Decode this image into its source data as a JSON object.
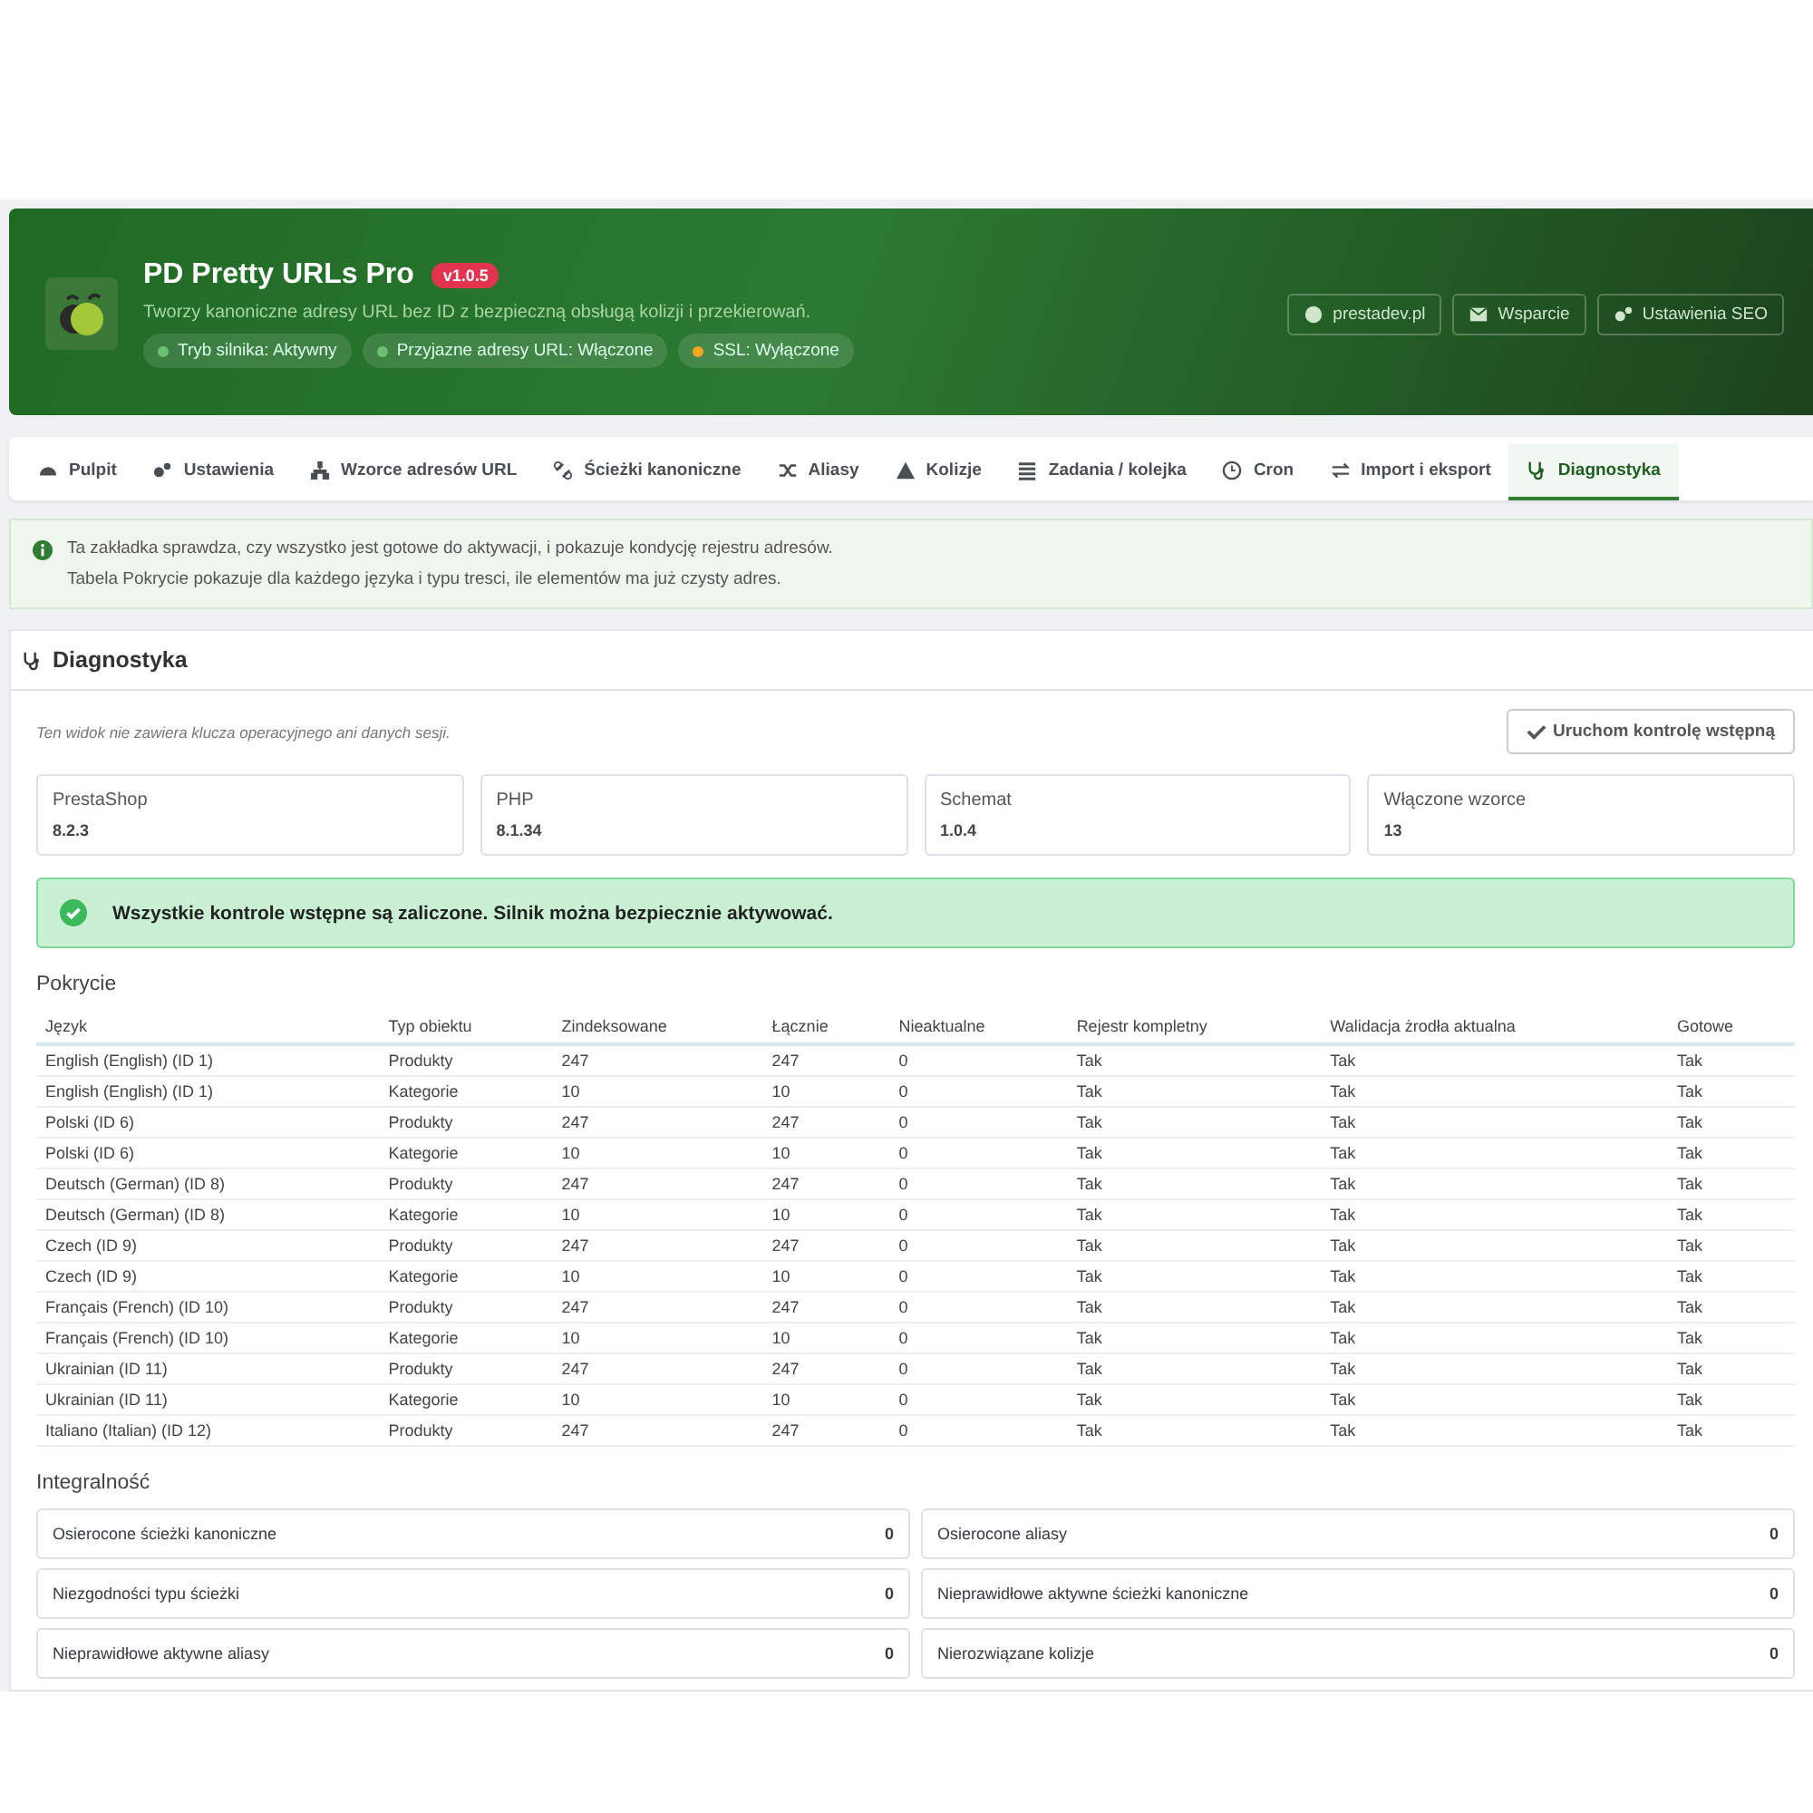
{
  "header": {
    "title": "PD Pretty URLs Pro",
    "version": "v1.0.5",
    "subtitle": "Tworzy kanoniczne adresy URL bez ID z bezpieczną obsługą kolizji i przekierowań.",
    "statuses": [
      {
        "label": "Tryb silnika: Aktywny",
        "color": "#6cc070"
      },
      {
        "label": "Przyjazne adresy URL: Włączone",
        "color": "#6cc070"
      },
      {
        "label": "SSL: Wyłączone",
        "color": "#f5a623"
      }
    ],
    "buttons": [
      "prestadev.pl",
      "Wsparcie",
      "Ustawienia SEO"
    ]
  },
  "tabs": [
    {
      "label": "Pulpit",
      "selected": false
    },
    {
      "label": "Ustawienia",
      "selected": false
    },
    {
      "label": "Wzorce adresów URL",
      "selected": false
    },
    {
      "label": "Ścieżki kanoniczne",
      "selected": false
    },
    {
      "label": "Aliasy",
      "selected": false
    },
    {
      "label": "Kolizje",
      "selected": false
    },
    {
      "label": "Zadania / kolejka",
      "selected": false
    },
    {
      "label": "Cron",
      "selected": false
    },
    {
      "label": "Import i eksport",
      "selected": false
    },
    {
      "label": "Diagnostyka",
      "selected": true
    }
  ],
  "info": [
    "Ta zakładka sprawdza, czy wszystko jest gotowe do aktywacji, i pokazuje kondycję rejestru adresów.",
    "Tabela Pokrycie pokazuje dla każdego języka i typu tresci, ile elementów ma już czysty adres."
  ],
  "panel": {
    "title": "Diagnostyka",
    "note": "Ten widok nie zawiera klucza operacyjnego ani danych sesji.",
    "run_button": "Uruchom kontrolę wstępną",
    "stats": [
      {
        "label": "PrestaShop",
        "value": "8.2.3"
      },
      {
        "label": "PHP",
        "value": "8.1.34"
      },
      {
        "label": "Schemat",
        "value": "1.0.4"
      },
      {
        "label": "Włączone wzorce",
        "value": "13"
      }
    ],
    "success": "Wszystkie kontrole wstępne są zaliczone. Silnik można bezpiecznie aktywować.",
    "coverage": {
      "title": "Pokrycie",
      "columns": [
        "Język",
        "Typ obiektu",
        "Zindeksowane",
        "Łącznie",
        "Nieaktualne",
        "Rejestr kompletny",
        "Walidacja żrodła aktualna",
        "Gotowe"
      ],
      "rows": [
        [
          "English (English) (ID 1)",
          "Produkty",
          "247",
          "247",
          "0",
          "Tak",
          "Tak",
          "Tak"
        ],
        [
          "English (English) (ID 1)",
          "Kategorie",
          "10",
          "10",
          "0",
          "Tak",
          "Tak",
          "Tak"
        ],
        [
          "Polski (ID 6)",
          "Produkty",
          "247",
          "247",
          "0",
          "Tak",
          "Tak",
          "Tak"
        ],
        [
          "Polski (ID 6)",
          "Kategorie",
          "10",
          "10",
          "0",
          "Tak",
          "Tak",
          "Tak"
        ],
        [
          "Deutsch (German) (ID 8)",
          "Produkty",
          "247",
          "247",
          "0",
          "Tak",
          "Tak",
          "Tak"
        ],
        [
          "Deutsch (German) (ID 8)",
          "Kategorie",
          "10",
          "10",
          "0",
          "Tak",
          "Tak",
          "Tak"
        ],
        [
          "Czech (ID 9)",
          "Produkty",
          "247",
          "247",
          "0",
          "Tak",
          "Tak",
          "Tak"
        ],
        [
          "Czech (ID 9)",
          "Kategorie",
          "10",
          "10",
          "0",
          "Tak",
          "Tak",
          "Tak"
        ],
        [
          "Français (French) (ID 10)",
          "Produkty",
          "247",
          "247",
          "0",
          "Tak",
          "Tak",
          "Tak"
        ],
        [
          "Français (French) (ID 10)",
          "Kategorie",
          "10",
          "10",
          "0",
          "Tak",
          "Tak",
          "Tak"
        ],
        [
          "Ukrainian (ID 11)",
          "Produkty",
          "247",
          "247",
          "0",
          "Tak",
          "Tak",
          "Tak"
        ],
        [
          "Ukrainian (ID 11)",
          "Kategorie",
          "10",
          "10",
          "0",
          "Tak",
          "Tak",
          "Tak"
        ],
        [
          "Italiano (Italian) (ID 12)",
          "Produkty",
          "247",
          "247",
          "0",
          "Tak",
          "Tak",
          "Tak"
        ]
      ]
    },
    "integrity": {
      "title": "Integralność",
      "items": [
        {
          "label": "Osierocone ścieżki kanoniczne",
          "value": "0"
        },
        {
          "label": "Osierocone aliasy",
          "value": "0"
        },
        {
          "label": "Niezgodności typu ścieżki",
          "value": "0"
        },
        {
          "label": "Nieprawidłowe aktywne ścieżki kanoniczne",
          "value": "0"
        },
        {
          "label": "Nieprawidłowe aktywne aliasy",
          "value": "0"
        },
        {
          "label": "Nierozwiązane kolizje",
          "value": "0"
        }
      ]
    }
  }
}
